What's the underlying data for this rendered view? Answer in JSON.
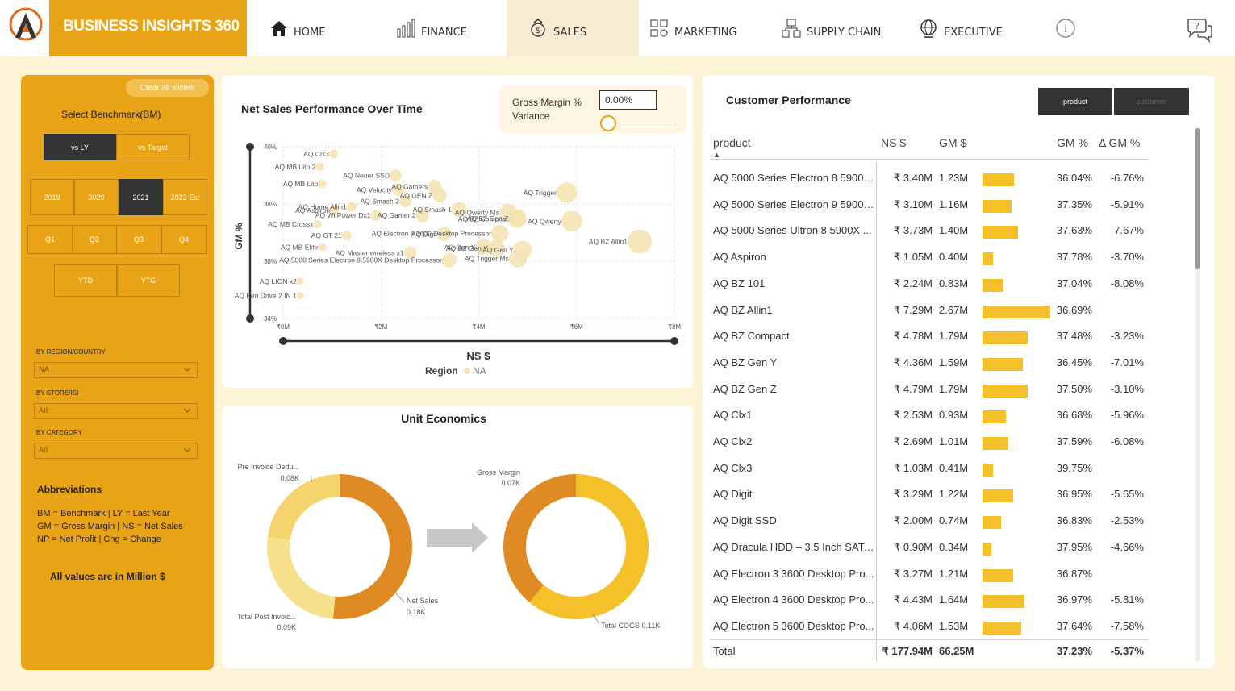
{
  "brand": {
    "title": "BUSINESS INSIGHTS 360"
  },
  "nav": [
    {
      "label": "HOME",
      "icon": "home-icon"
    },
    {
      "label": "FINANCE",
      "icon": "finance-chart-icon"
    },
    {
      "label": "SALES",
      "icon": "sales-money-icon",
      "active": true
    },
    {
      "label": "MARKETING",
      "icon": "marketing-icon"
    },
    {
      "label": "SUPPLY CHAIN",
      "icon": "supply-chain-icon"
    },
    {
      "label": "EXECUTIVE",
      "icon": "executive-globe-icon"
    }
  ],
  "sidebar": {
    "clear_label": "Clear all slicers",
    "benchmark_title": "Select Benchmark(BM)",
    "benchmarks": [
      "vs LY",
      "vs Target"
    ],
    "benchmark_selected": "vs LY",
    "years": [
      "2019",
      "2020",
      "2021",
      "2022 Est"
    ],
    "year_selected": "2021",
    "quarters": [
      "Q1",
      "Q2",
      "Q3",
      "Q4"
    ],
    "periods": [
      "YTD",
      "YTG"
    ],
    "filters": [
      {
        "label": "BY REGION/COUNTRY",
        "value": "NA"
      },
      {
        "label": "BY STORE/ISI",
        "value": "All"
      },
      {
        "label": "BY CATEGORY",
        "value": "All"
      }
    ],
    "abbr_title": "Abbreviations",
    "abbr_lines": [
      "BM = Benchmark | LY = Last Year",
      "GM = Gross Margin | NS = Net Sales",
      "NP = Net Profit | Chg = Change"
    ],
    "note": "All values are in Million $"
  },
  "scatter": {
    "title": "Net Sales Performance Over Time",
    "gm_variance_label_1": "Gross Margin %",
    "gm_variance_label_2": "Variance",
    "gm_variance_value": "0.00%",
    "slider_fraction": 0,
    "xlabel": "NS $",
    "ylabel": "GM %",
    "legend_title": "Region",
    "legend_item": "NA",
    "point_color": "#f5e2b0"
  },
  "chart_data": [
    {
      "type": "scatter",
      "title": "Net Sales Performance Over Time",
      "xlabel": "NS $",
      "ylabel": "GM %",
      "xlim": [
        0,
        8
      ],
      "ylim": [
        34,
        40
      ],
      "xticks": [
        "₹0M",
        "₹2M",
        "₹4M",
        "₹6M",
        "₹8M"
      ],
      "yticks": [
        "40%",
        "38%",
        "36%",
        "34%"
      ],
      "legend": "Region: NA",
      "points": [
        {
          "label": "AQ Clx3",
          "x": 1.03,
          "y": 39.75
        },
        {
          "label": "AQ MB Lito 2",
          "x": 0.75,
          "y": 39.3
        },
        {
          "label": "AQ Neuer SSD",
          "x": 2.3,
          "y": 39.0
        },
        {
          "label": "AQ Gamers",
          "x": 3.1,
          "y": 38.6
        },
        {
          "label": "AQ MB Lito",
          "x": 0.8,
          "y": 38.7
        },
        {
          "label": "AQ Velocity",
          "x": 2.35,
          "y": 38.5
        },
        {
          "label": "AQ GEN Z",
          "x": 3.2,
          "y": 38.3
        },
        {
          "label": "AQ BZ Compact",
          "x": 4.78,
          "y": 37.48
        },
        {
          "label": "AQ Trigger",
          "x": 5.8,
          "y": 38.4
        },
        {
          "label": "AQ Smash 2",
          "x": 2.5,
          "y": 38.1
        },
        {
          "label": "AQ Home Allin1",
          "x": 1.4,
          "y": 37.9
        },
        {
          "label": "AQ Smash 1",
          "x": 3.6,
          "y": 37.8
        },
        {
          "label": "AQ Qwerty Ms",
          "x": 4.6,
          "y": 37.7
        },
        {
          "label": "AQ Aspiron",
          "x": 1.05,
          "y": 37.78
        },
        {
          "label": "AQ Wi Power Dx1",
          "x": 1.9,
          "y": 37.6
        },
        {
          "label": "AQ Gamer 2",
          "x": 2.85,
          "y": 37.6
        },
        {
          "label": "AQ Qwerty",
          "x": 5.9,
          "y": 37.4
        },
        {
          "label": "AQ MB Crossx",
          "x": 0.7,
          "y": 37.3
        },
        {
          "label": "AQ Electron 4 3600 Desktop Processor",
          "x": 4.43,
          "y": 36.97
        },
        {
          "label": "AQ GT 21",
          "x": 1.3,
          "y": 36.9
        },
        {
          "label": "AQ BZ Gen Z",
          "x": 4.79,
          "y": 37.5
        },
        {
          "label": "AQ Digit",
          "x": 3.29,
          "y": 36.95
        },
        {
          "label": "AQ Gen Y",
          "x": 4.9,
          "y": 36.4
        },
        {
          "label": "AQ MB Elite",
          "x": 0.8,
          "y": 36.5
        },
        {
          "label": "AQ Master wireless x1",
          "x": 2.6,
          "y": 36.3
        },
        {
          "label": "AQ Gen X",
          "x": 4.1,
          "y": 36.5
        },
        {
          "label": "AQ BZ Allin1",
          "x": 7.29,
          "y": 36.69
        },
        {
          "label": "AQ BZ Gen Y",
          "x": 4.36,
          "y": 36.45
        },
        {
          "label": "AQ Trigger Ms",
          "x": 4.8,
          "y": 36.1
        },
        {
          "label": "AQ 5000 Series Electron 8 5900X Desktop Processor",
          "x": 3.4,
          "y": 36.04
        },
        {
          "label": "AQ LION x2",
          "x": 0.35,
          "y": 35.3
        },
        {
          "label": "AQ Pen Drive 2 IN 1",
          "x": 0.35,
          "y": 34.8
        }
      ]
    },
    {
      "type": "pie",
      "title": "Unit Economics",
      "donuts": [
        {
          "slices": [
            {
              "label": "Pre Invoice Dedu...",
              "value": "0.08K",
              "amount": 0.08
            },
            {
              "label": "Total Post Invoic...",
              "value": "0.09K",
              "amount": 0.09
            },
            {
              "label": "Net Sales",
              "value": "0.18K",
              "amount": 0.18
            }
          ]
        },
        {
          "slices": [
            {
              "label": "Gross Margin",
              "value": "0.07K",
              "amount": 0.07
            },
            {
              "label": "Total COGS",
              "value": "0.11K",
              "amount": 0.11
            }
          ]
        }
      ]
    }
  ],
  "unit_econ": {
    "title": "Unit Economics",
    "d1": {
      "pre_label": "Pre Invoice Dedu...",
      "pre_value": "0.08K",
      "post_label": "Total Post Invoic...",
      "post_value": "0.09K",
      "ns_label": "Net Sales",
      "ns_value": "0.18K"
    },
    "d2": {
      "gm_label": "Gross Margin",
      "gm_value": "0.07K",
      "cogs_label": "Total COGS 0.11K"
    },
    "colors": {
      "dark": "#e08a24",
      "light": "#f5d46e",
      "yellow": "#f4c12a",
      "pale": "#f7e08c"
    }
  },
  "customer": {
    "title": "Customer Performance",
    "toggle": [
      "product",
      "customer"
    ],
    "headers": {
      "product": "product",
      "ns": "NS $",
      "gm": "GM $",
      "gmp": "GM %",
      "dgm": "Δ GM %"
    },
    "rows": [
      {
        "product": "AQ 5000 Series Electron 8 5900X...",
        "ns": "₹ 3.40M",
        "gm": "1.23M",
        "bar": 1.23,
        "gmp": "36.04%",
        "dgm": "-6.76%"
      },
      {
        "product": "AQ 5000 Series Electron 9 5900X...",
        "ns": "₹ 3.10M",
        "gm": "1.16M",
        "bar": 1.16,
        "gmp": "37.35%",
        "dgm": "-5.91%"
      },
      {
        "product": "AQ 5000 Series Ultron 8 5900X ...",
        "ns": "₹ 3.73M",
        "gm": "1.40M",
        "bar": 1.4,
        "gmp": "37.63%",
        "dgm": "-7.67%"
      },
      {
        "product": "AQ Aspiron",
        "ns": "₹ 1.05M",
        "gm": "0.40M",
        "bar": 0.4,
        "gmp": "37.78%",
        "dgm": "-3.70%"
      },
      {
        "product": "AQ BZ 101",
        "ns": "₹ 2.24M",
        "gm": "0.83M",
        "bar": 0.83,
        "gmp": "37.04%",
        "dgm": "-8.08%"
      },
      {
        "product": "AQ BZ Allin1",
        "ns": "₹ 7.29M",
        "gm": "2.67M",
        "bar": 2.67,
        "gmp": "36.69%",
        "dgm": ""
      },
      {
        "product": "AQ BZ Compact",
        "ns": "₹ 4.78M",
        "gm": "1.79M",
        "bar": 1.79,
        "gmp": "37.48%",
        "dgm": "-3.23%"
      },
      {
        "product": "AQ BZ Gen Y",
        "ns": "₹ 4.36M",
        "gm": "1.59M",
        "bar": 1.59,
        "gmp": "36.45%",
        "dgm": "-7.01%"
      },
      {
        "product": "AQ BZ Gen Z",
        "ns": "₹ 4.79M",
        "gm": "1.79M",
        "bar": 1.79,
        "gmp": "37.50%",
        "dgm": "-3.10%"
      },
      {
        "product": "AQ Clx1",
        "ns": "₹ 2.53M",
        "gm": "0.93M",
        "bar": 0.93,
        "gmp": "36.68%",
        "dgm": "-5.96%"
      },
      {
        "product": "AQ Clx2",
        "ns": "₹ 2.69M",
        "gm": "1.01M",
        "bar": 1.01,
        "gmp": "37.59%",
        "dgm": "-6.08%"
      },
      {
        "product": "AQ Clx3",
        "ns": "₹ 1.03M",
        "gm": "0.41M",
        "bar": 0.41,
        "gmp": "39.75%",
        "dgm": ""
      },
      {
        "product": "AQ Digit",
        "ns": "₹ 3.29M",
        "gm": "1.22M",
        "bar": 1.22,
        "gmp": "36.95%",
        "dgm": "-5.65%"
      },
      {
        "product": "AQ Digit SSD",
        "ns": "₹ 2.00M",
        "gm": "0.74M",
        "bar": 0.74,
        "gmp": "36.83%",
        "dgm": "-2.53%"
      },
      {
        "product": "AQ Dracula HDD – 3.5 Inch SATA...",
        "ns": "₹ 0.90M",
        "gm": "0.34M",
        "bar": 0.34,
        "gmp": "37.95%",
        "dgm": "-4.66%"
      },
      {
        "product": "AQ Electron 3 3600 Desktop Pro...",
        "ns": "₹ 3.27M",
        "gm": "1.21M",
        "bar": 1.21,
        "gmp": "36.87%",
        "dgm": ""
      },
      {
        "product": "AQ Electron 4 3600 Desktop Pro...",
        "ns": "₹ 4.43M",
        "gm": "1.64M",
        "bar": 1.64,
        "gmp": "36.97%",
        "dgm": "-5.81%"
      },
      {
        "product": "AQ Electron 5 3600 Desktop Pro...",
        "ns": "₹ 4.06M",
        "gm": "1.53M",
        "bar": 1.53,
        "gmp": "37.64%",
        "dgm": "-7.58%"
      }
    ],
    "total": {
      "label": "Total",
      "ns": "₹ 177.94M",
      "gm": "66.25M",
      "gmp": "37.23%",
      "dgm": "-5.37%"
    },
    "bar_max": 2.67,
    "bar_color": "#f4c12a"
  }
}
